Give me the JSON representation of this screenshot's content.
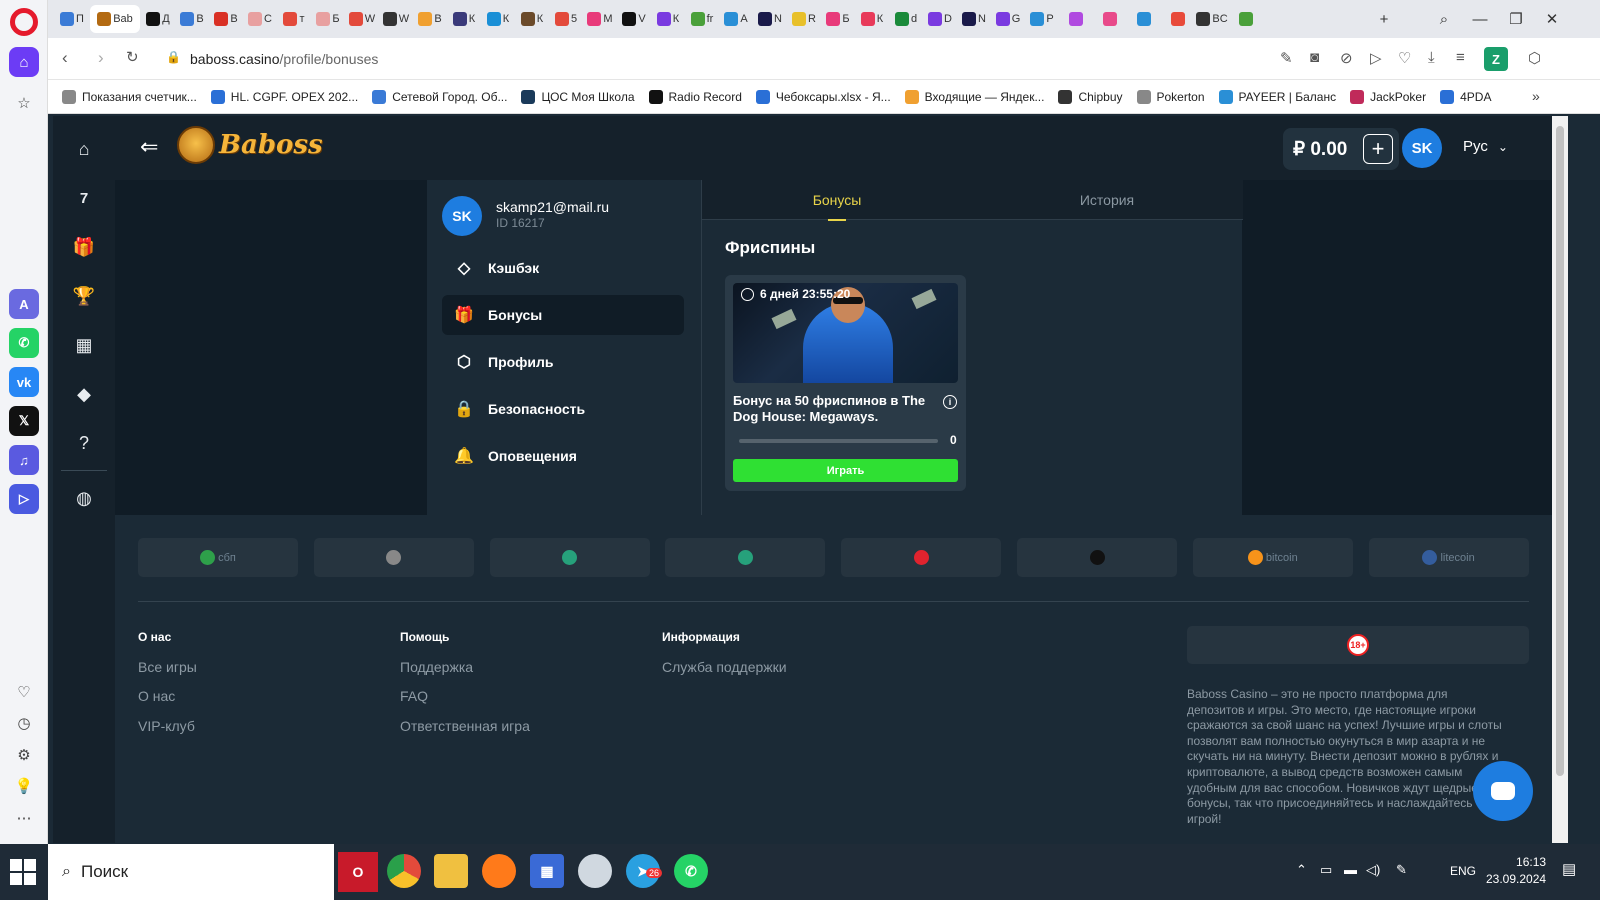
{
  "browser": {
    "tabs": [
      {
        "label": "П",
        "color": "#3b7bd6"
      },
      {
        "label": "Bab",
        "color": "#b36a12",
        "active": true
      },
      {
        "label": "Д",
        "color": "#111"
      },
      {
        "label": "В",
        "color": "#3b7bd6"
      },
      {
        "label": "В",
        "color": "#d93025"
      },
      {
        "label": "С",
        "color": "#e8a0a0"
      },
      {
        "label": "т",
        "color": "#e34a3b"
      },
      {
        "label": "Б",
        "color": "#e8a0a0"
      },
      {
        "label": "W",
        "color": "#e34a3b"
      },
      {
        "label": "W",
        "color": "#333"
      },
      {
        "label": "В",
        "color": "#f0a030"
      },
      {
        "label": "К",
        "color": "#3a3a7a"
      },
      {
        "label": "К",
        "color": "#1a8fd6"
      },
      {
        "label": "К",
        "color": "#6b4a2a"
      },
      {
        "label": "5",
        "color": "#e34a3b"
      },
      {
        "label": "М",
        "color": "#e83a7a"
      },
      {
        "label": "V",
        "color": "#111"
      },
      {
        "label": "К",
        "color": "#7a3ae0"
      },
      {
        "label": "fr",
        "color": "#4aa03a"
      },
      {
        "label": "А",
        "color": "#2a8fd6"
      },
      {
        "label": "N",
        "color": "#1a1a4a"
      },
      {
        "label": "R",
        "color": "#e8c02a"
      },
      {
        "label": "Б",
        "color": "#e83a7a"
      },
      {
        "label": "К",
        "color": "#e83a5a"
      },
      {
        "label": "d",
        "color": "#1a8a3a"
      },
      {
        "label": "D",
        "color": "#7a3ae0"
      },
      {
        "label": "N",
        "color": "#1a1a4a"
      },
      {
        "label": "G",
        "color": "#7a3ae0"
      },
      {
        "label": "P",
        "color": "#2a8fd6"
      },
      {
        "label": "",
        "color": "#b04ae0"
      },
      {
        "label": "",
        "color": "#e84a8a"
      },
      {
        "label": "",
        "color": "#2a8fd6"
      },
      {
        "label": "",
        "color": "#e84a3a"
      },
      {
        "label": "BC",
        "color": "#333"
      },
      {
        "label": "",
        "color": "#4aa03a"
      }
    ],
    "url_domain": "baboss.casino",
    "url_path": "/profile/bonuses",
    "extension_label": "Z",
    "bookmarks": [
      {
        "label": "Показания счетчик...",
        "color": "#888"
      },
      {
        "label": "HL. CGPF. OPEX 202...",
        "color": "#2a6fd6"
      },
      {
        "label": "Сетевой Город. Об...",
        "color": "#3a7ad6"
      },
      {
        "label": "ЦОС Моя Школа",
        "color": "#1a3a5a"
      },
      {
        "label": "Radio Record",
        "color": "#111"
      },
      {
        "label": "Чебоксары.xlsx - Я...",
        "color": "#2a6fd6"
      },
      {
        "label": "Входящие — Яндек...",
        "color": "#f0a030"
      },
      {
        "label": "Chipbuy",
        "color": "#333"
      },
      {
        "label": "Pokerton",
        "color": "#888"
      },
      {
        "label": "PAYEER | Баланс",
        "color": "#2a8fd6"
      },
      {
        "label": "JackPoker",
        "color": "#c02a5a"
      },
      {
        "label": "4PDA",
        "color": "#2a6fd6"
      }
    ]
  },
  "site": {
    "brand": "Baboss",
    "balance": "₽ 0.00",
    "user_initials": "SK",
    "language": "Рус"
  },
  "profile": {
    "initials": "SK",
    "email": "skamp21@mail.ru",
    "id": "ID 16217",
    "menu": [
      {
        "label": "Кэшбэк",
        "icon": "diamond-icon",
        "glyph": "◇"
      },
      {
        "label": "Бонусы",
        "icon": "gift-icon",
        "glyph": "🎁",
        "active": true
      },
      {
        "label": "Профиль",
        "icon": "profile-icon",
        "glyph": "⬡"
      },
      {
        "label": "Безопасность",
        "icon": "lock-icon",
        "glyph": "🔒"
      },
      {
        "label": "Оповещения",
        "icon": "bell-icon",
        "glyph": "🔔"
      }
    ]
  },
  "bonuses": {
    "tabs": [
      {
        "label": "Бонусы",
        "active": true
      },
      {
        "label": "История"
      }
    ],
    "section_title": "Фриспины",
    "card": {
      "timer": "6 дней 23:55:20",
      "title": "Бонус на 50 фриспинов в The Dog House: Megaways.",
      "progress_value": "0",
      "progress_fraction": 0,
      "play_label": "Играть"
    }
  },
  "payments": [
    {
      "name": "sbp",
      "label": "сбп"
    },
    {
      "name": "card",
      "label": ""
    },
    {
      "name": "tether-trc",
      "label": ""
    },
    {
      "name": "toncoin",
      "label": ""
    },
    {
      "name": "tron",
      "label": ""
    },
    {
      "name": "ethereum",
      "label": ""
    },
    {
      "name": "bitcoin",
      "label": "bitcoin"
    },
    {
      "name": "litecoin",
      "label": "litecoin"
    }
  ],
  "footer": {
    "columns": [
      {
        "heading": "О нас",
        "links": [
          "Все игры",
          "О нас",
          "VIP-клуб"
        ]
      },
      {
        "heading": "Помощь",
        "links": [
          "Поддержка",
          "FAQ",
          "Ответственная игра"
        ]
      },
      {
        "heading": "Информация",
        "links": [
          "Служба поддержки"
        ]
      }
    ],
    "age_badge": "18+",
    "about": "Baboss Casino – это не просто платформа для депозитов и игры. Это место, где настоящие игроки сражаются за свой шанс на успех! Лучшие игры и слоты позволят вам полностью окунуться в мир азарта и не скучать ни на минуту. Внести депозит можно в рублях и криптовалюте, а вывод средств возможен самым удобным для вас способом. Новичков ждут щедрые бонусы, так что присоединяйтесь и наслаждайтесь игрой!"
  },
  "taskbar": {
    "search_placeholder": "Поиск",
    "language": "ENG",
    "time": "16:13",
    "date": "23.09.2024",
    "telegram_badge": "26"
  }
}
